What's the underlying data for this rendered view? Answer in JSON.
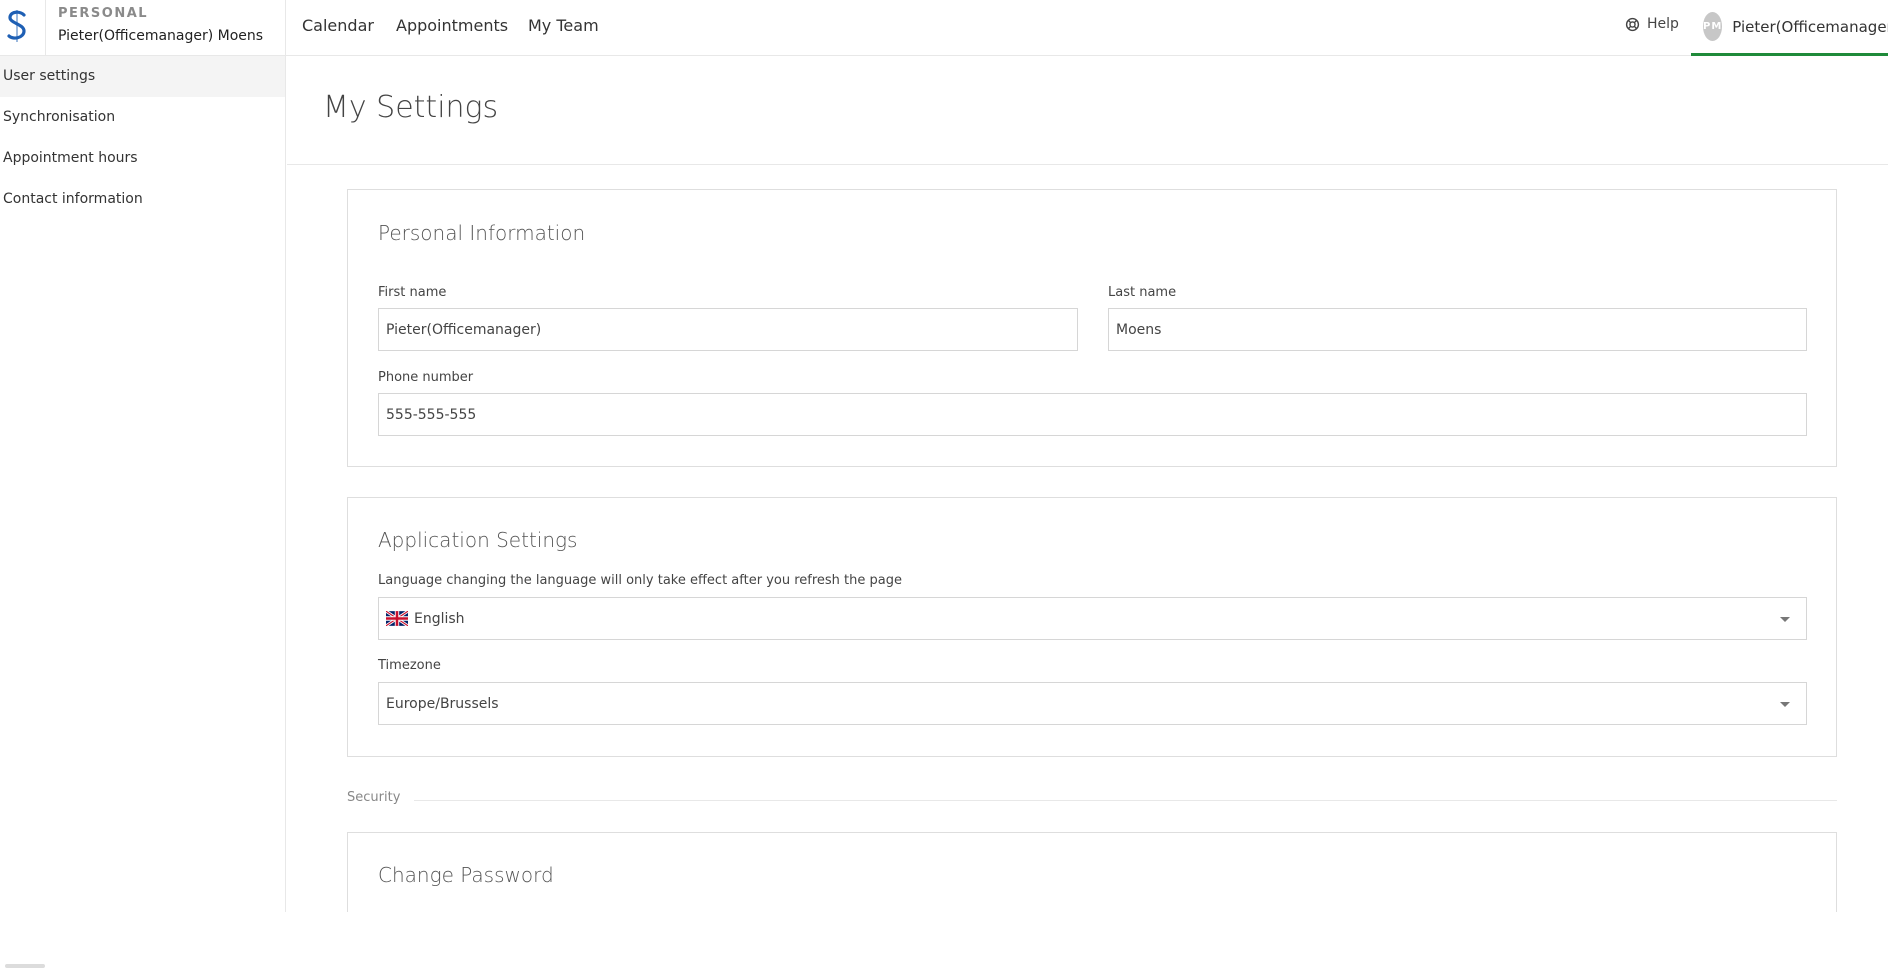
{
  "brand": {
    "kicker": "PERSONAL",
    "user": "Pieter(Officemanager) Moens",
    "logo_icon": "s-logo-icon",
    "logo_color": "#1e5fb4"
  },
  "nav": {
    "items": [
      "Calendar",
      "Appointments",
      "My Team"
    ],
    "help": "Help",
    "help_icon": "lifebuoy-icon",
    "avatar": "PM",
    "user": "Pieter(Officemanager)",
    "accent_color": "#1f8a3a"
  },
  "sidebar": {
    "items": [
      {
        "label": "User settings",
        "active": true
      },
      {
        "label": "Synchronisation",
        "active": false
      },
      {
        "label": "Appointment hours",
        "active": false
      },
      {
        "label": "Contact information",
        "active": false
      }
    ]
  },
  "page": {
    "title": "My Settings"
  },
  "personal": {
    "title": "Personal Information",
    "first_name_label": "First name",
    "first_name": "Pieter(Officemanager)",
    "last_name_label": "Last name",
    "last_name": "Moens",
    "phone_label": "Phone number",
    "phone": "555-555-555"
  },
  "app_settings": {
    "title": "Application Settings",
    "language_label": "Language changing the language will only take effect after you refresh the page",
    "language": "English",
    "language_flag": "uk-flag-icon",
    "timezone_label": "Timezone",
    "timezone": "Europe/Brussels"
  },
  "security": {
    "section_label": "Security",
    "change_password_title": "Change Password"
  }
}
